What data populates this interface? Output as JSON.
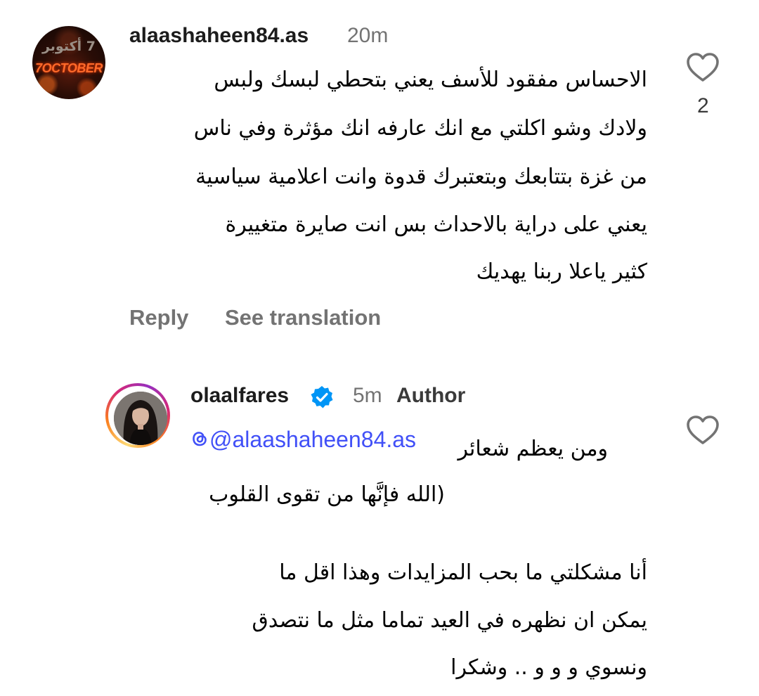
{
  "comment": {
    "avatar": {
      "arabic_text": "7 أكتوبر",
      "english_text": "7OCTOBER"
    },
    "username": "alaashaheen84.as",
    "time": "20m",
    "lines": [
      "الاحساس مفقود للأسف يعني بتحطي لبسك ولبس",
      "ولادك وشو اكلتي مع انك عارفه انك مؤثرة وفي ناس",
      "من غزة بتتابعك وبتعتبرك قدوة وانت اعلامية سياسية",
      "يعني على دراية بالاحداث بس انت صايرة متغييرة",
      "كثير ياعلا ربنا يهديك"
    ],
    "like_count": "2",
    "reply_label": "Reply",
    "translate_label": "See translation"
  },
  "reply": {
    "username": "olaalfares",
    "time": "5m",
    "author_badge": "Author",
    "mention": "@alaashaheen84.as",
    "lines": [
      "ومن يعظم شعائر",
      "(الله فإنَّها من تقوى القلوب",
      "أنا مشكلتي ما بحب المزايدات وهذا اقل ما",
      "يمكن ان نظهره في العيد تماما مثل ما نتصدق",
      "ونسوي و و و .. وشكرا"
    ]
  },
  "colors": {
    "meta_gray": "#737373",
    "mention_blue": "#4150f7",
    "verified_blue": "#0095f6",
    "icon_gray": "#737373"
  },
  "icons": {
    "like": "heart-outline-icon",
    "verified": "verified-badge-icon",
    "mention_prefix": "threads-icon"
  }
}
